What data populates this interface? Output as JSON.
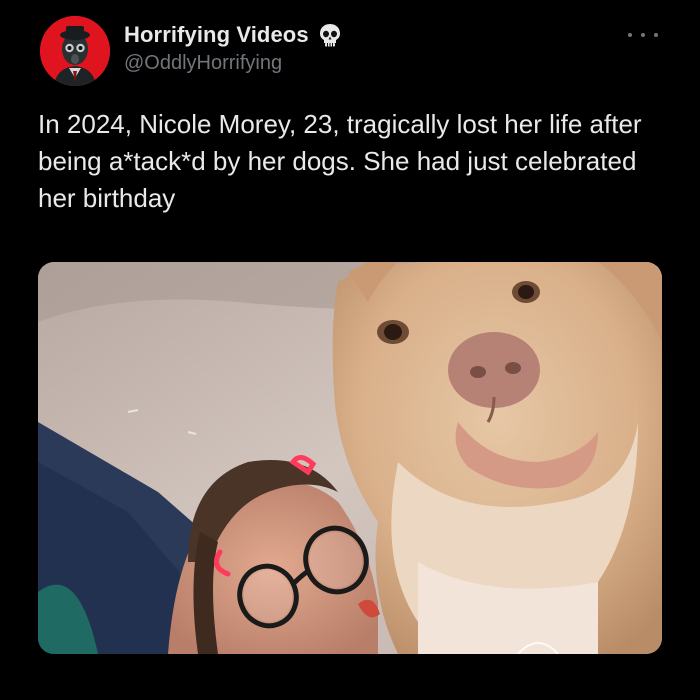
{
  "tweet": {
    "author": {
      "display_name": "Horrifying Videos",
      "handle": "@OddlyHorrifying",
      "badge_icon": "skull-icon",
      "avatar_color": "#e0141f"
    },
    "more_icon": "more-dots-icon",
    "text": "In 2024, Nicole Morey, 23, tragically lost her life after being a*tack*d by her dogs. She had just celebrated her birthday",
    "media": {
      "icon": "photo-woman-and-dog"
    }
  },
  "colors": {
    "background": "#000000",
    "primary_text": "#e7e9ea",
    "secondary_text": "#71767b"
  }
}
